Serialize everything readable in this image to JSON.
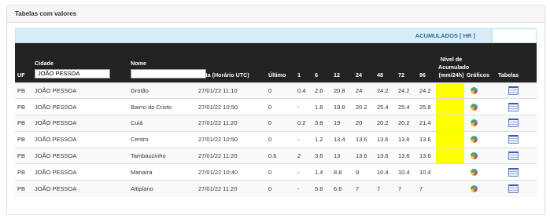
{
  "panel": {
    "title": "Tabelas com valores"
  },
  "accumulated_label": "ACUMULADOS [ HR ]",
  "headers": {
    "uf": "UF",
    "cidade": "Cidade",
    "nome": "Nome",
    "data": "Data (Horário UTC)",
    "ultimo": "Último",
    "h1": "1",
    "h6": "6",
    "h12": "12",
    "h24": "24",
    "h48": "48",
    "h72": "72",
    "h96": "96",
    "nivel": "Nível de Acumulado (mm/24h)",
    "graficos": "Gráficos",
    "tabelas": "Tabelas"
  },
  "filters": {
    "cidade_value": "JOÃO PESSOA",
    "nome_value": ""
  },
  "highlight_color": "#ffff00",
  "icons": {
    "chart": "pie-chart-icon",
    "table": "table-icon"
  },
  "rows": [
    {
      "uf": "PB",
      "cidade": "JOÃO PESSOA",
      "nome": "Grotão",
      "data": "27/01/22 11:10",
      "ultimo": "0",
      "h1": "0.4",
      "h6": "2.6",
      "h12": "20.8",
      "h24": "24",
      "h48": "24.2",
      "h72": "24.2",
      "h96": "24.2",
      "nivel": "yellow"
    },
    {
      "uf": "PB",
      "cidade": "JOÃO PESSOA",
      "nome": "Bairro do Cristo",
      "data": "27/01/22 10:50",
      "ultimo": "0",
      "h1": "-",
      "h6": "1.8",
      "h12": "19.8",
      "h24": "20.2",
      "h48": "25.4",
      "h72": "25.4",
      "h96": "25.8",
      "nivel": "yellow"
    },
    {
      "uf": "PB",
      "cidade": "JOÃO PESSOA",
      "nome": "Cuiá",
      "data": "27/01/22 11:20",
      "ultimo": "0",
      "h1": "0.2",
      "h6": "3.8",
      "h12": "19",
      "h24": "20",
      "h48": "20.2",
      "h72": "20.2",
      "h96": "21.4",
      "nivel": "yellow"
    },
    {
      "uf": "PB",
      "cidade": "JOÃO PESSOA",
      "nome": "Centro",
      "data": "27/01/22 10:50",
      "ultimo": "0",
      "h1": "-",
      "h6": "1.2",
      "h12": "13.4",
      "h24": "13.6",
      "h48": "13.6",
      "h72": "13.6",
      "h96": "13.6",
      "nivel": "yellow"
    },
    {
      "uf": "PB",
      "cidade": "JOÃO PESSOA",
      "nome": "Tambauzinho",
      "data": "27/01/22 11:20",
      "ultimo": "0.6",
      "h1": "2",
      "h6": "3.6",
      "h12": "13",
      "h24": "13.6",
      "h48": "13.6",
      "h72": "13.6",
      "h96": "13.6",
      "nivel": "yellow"
    },
    {
      "uf": "PB",
      "cidade": "JOÃO PESSOA",
      "nome": "Manaíra",
      "data": "27/01/22 10:40",
      "ultimo": "0",
      "h1": "-",
      "h6": "1.4",
      "h12": "8.8",
      "h24": "9",
      "h48": "10.4",
      "h72": "10.4",
      "h96": "10.4",
      "nivel": ""
    },
    {
      "uf": "PB",
      "cidade": "JOÃO PESSOA",
      "nome": "Altiplano",
      "data": "27/01/22 11:20",
      "ultimo": "0",
      "h1": "-",
      "h6": "5.6",
      "h12": "6.6",
      "h24": "7",
      "h48": "7",
      "h72": "7",
      "h96": "7",
      "nivel": ""
    }
  ]
}
